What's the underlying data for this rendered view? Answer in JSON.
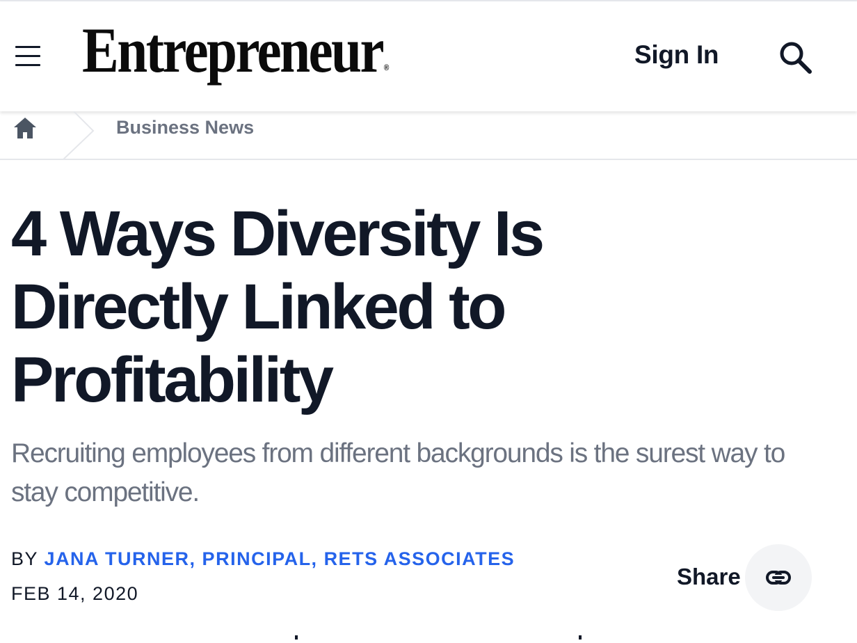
{
  "header": {
    "logo_text": "Entrepreneur",
    "logo_mark": "®",
    "sign_in_label": "Sign In",
    "menu_icon": "hamburger-menu-icon",
    "search_icon": "search-icon"
  },
  "breadcrumb": {
    "home_icon": "home-icon",
    "section": "Business News"
  },
  "article": {
    "title": "4 Ways Diversity Is Directly Linked to Profitability",
    "subtitle": "Recruiting employees from different backgrounds is the surest way to stay competitive.",
    "by_prefix": "BY",
    "author": "JANA TURNER, PRINCIPAL, RETS ASSOCIATES",
    "date": "FEB 14, 2020"
  },
  "share": {
    "label": "Share",
    "icon": "link-icon"
  },
  "colors": {
    "text": "#111827",
    "muted": "#6b7280",
    "author_link": "#2563eb",
    "share_bg": "#f3f4f6"
  }
}
